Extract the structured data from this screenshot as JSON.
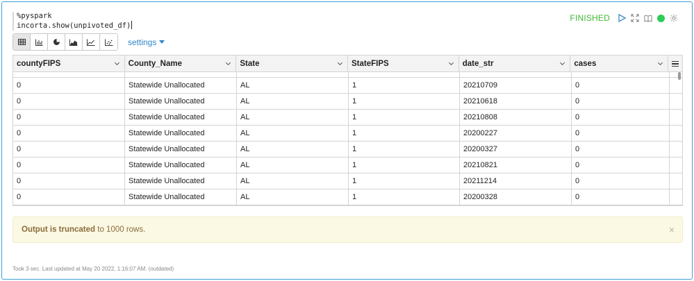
{
  "code": {
    "lines": [
      "%pyspark",
      "incorta.show(unpivoted_df)"
    ]
  },
  "status": {
    "text": "FINISHED",
    "run_icon": "play-icon",
    "maximize_icon": "expand-icon",
    "book_icon": "book-icon",
    "status_dot_color": "#2fcc55",
    "settings_icon": "gear-icon"
  },
  "toolbar": {
    "views": [
      "table-icon",
      "bar-chart-icon",
      "pie-chart-icon",
      "area-chart-icon",
      "line-chart-icon",
      "scatter-chart-icon"
    ],
    "settings_label": "settings"
  },
  "table": {
    "columns": [
      "countyFIPS",
      "County_Name",
      "State",
      "StateFIPS",
      "date_str",
      "cases"
    ],
    "rows": [
      [
        "0",
        "Statewide Unallocated",
        "AL",
        "1",
        "20210709",
        "0"
      ],
      [
        "0",
        "Statewide Unallocated",
        "AL",
        "1",
        "20210618",
        "0"
      ],
      [
        "0",
        "Statewide Unallocated",
        "AL",
        "1",
        "20210808",
        "0"
      ],
      [
        "0",
        "Statewide Unallocated",
        "AL",
        "1",
        "20200227",
        "0"
      ],
      [
        "0",
        "Statewide Unallocated",
        "AL",
        "1",
        "20200327",
        "0"
      ],
      [
        "0",
        "Statewide Unallocated",
        "AL",
        "1",
        "20210821",
        "0"
      ],
      [
        "0",
        "Statewide Unallocated",
        "AL",
        "1",
        "20211214",
        "0"
      ],
      [
        "0",
        "Statewide Unallocated",
        "AL",
        "1",
        "20200328",
        "0"
      ]
    ]
  },
  "notice": {
    "bold": "Output is truncated",
    "rest": " to 1000 rows.",
    "close": "×"
  },
  "footer": {
    "text": "Took 3 sec. Last updated at May 20 2022, 1:16:07 AM. (outdated)"
  }
}
